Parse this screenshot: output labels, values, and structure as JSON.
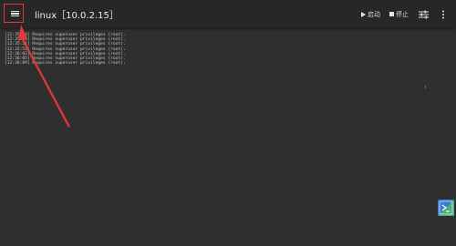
{
  "toolbar": {
    "title": "linux［10.0.2.15］",
    "start_label": "启动",
    "stop_label": "停止",
    "menu_icon": "hamburger-menu-icon",
    "settings_icon": "sliders-icon",
    "more_icon": "more-vertical-icon"
  },
  "console": {
    "lines": [
      "[12:35:24] Requires superuser privileges (root).",
      "[12:35:28] Requires superuser privileges (root).",
      "[12:35:31] Requires superuser privileges (root).",
      "[12:35:51] Requires superuser privileges (root).",
      "[12:36:03] Requires superuser privileges (root).",
      "[12:36:05] Requires superuser privileges (root).",
      "[12:36:09] Requires superuser privileges (root)."
    ]
  },
  "annotation": {
    "color": "#e2373b"
  },
  "colors": {
    "background": "#2f2f2f",
    "toolbar": "#272727",
    "text": "#ececec"
  }
}
